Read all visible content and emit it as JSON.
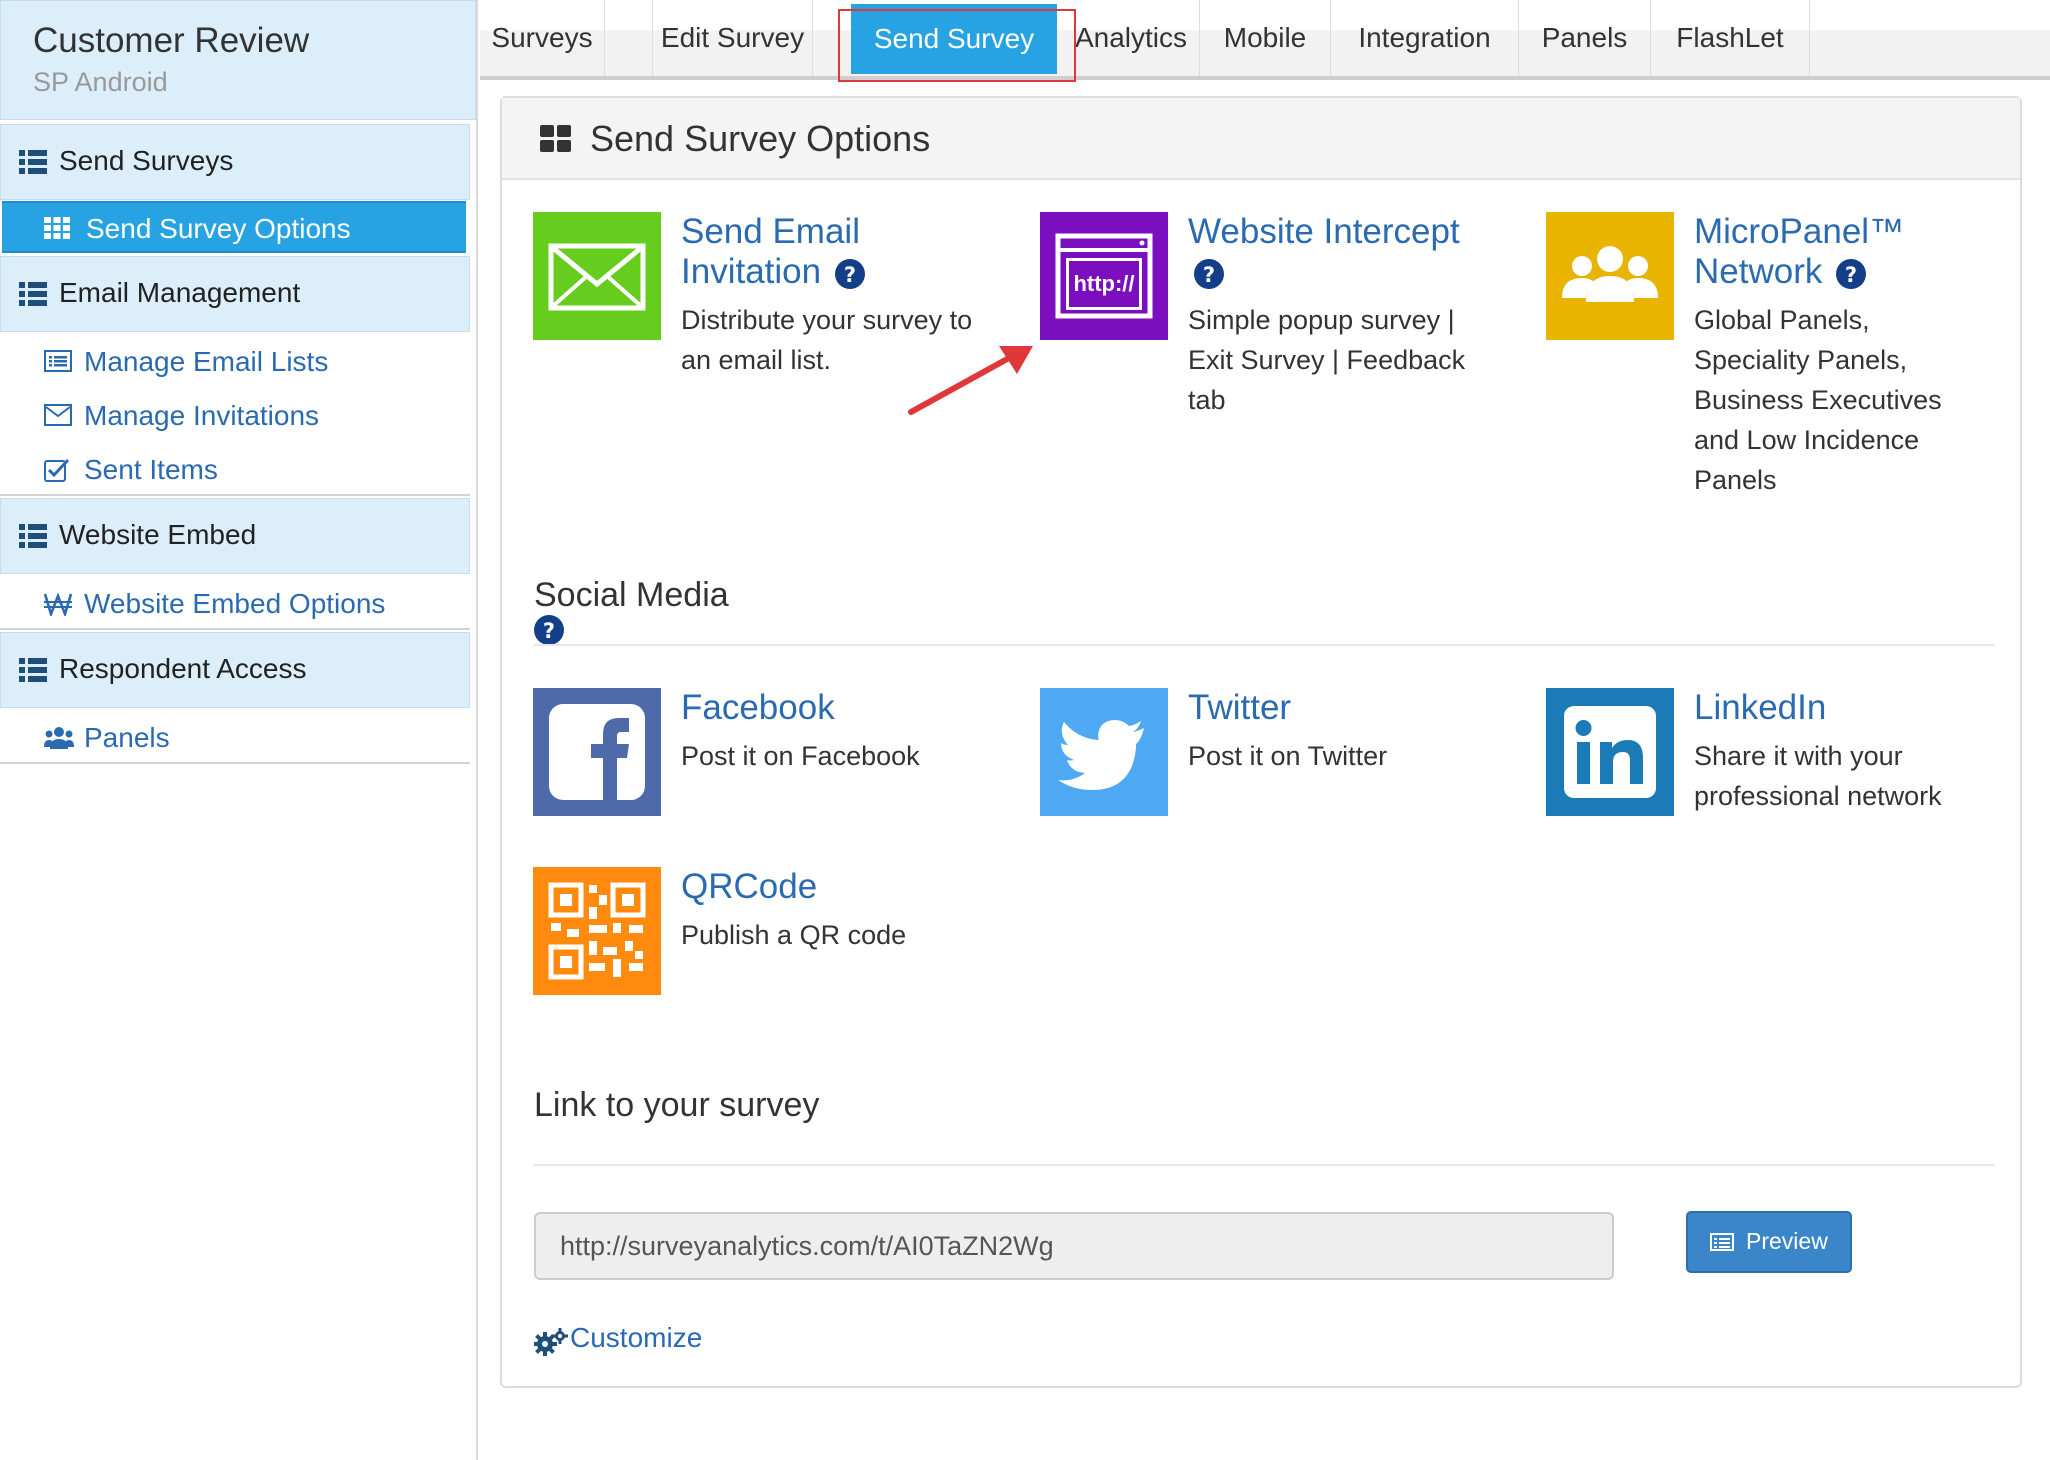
{
  "sidebar": {
    "title": "Customer Review",
    "subtitle": "SP Android",
    "sections": [
      {
        "label": "Send Surveys",
        "items": [
          {
            "label": "Send Survey Options",
            "icon": "grid-icon",
            "active": true
          }
        ]
      },
      {
        "label": "Email Management",
        "items": [
          {
            "label": "Manage Email Lists",
            "icon": "list-icon"
          },
          {
            "label": "Manage Invitations",
            "icon": "envelope-icon"
          },
          {
            "label": "Sent Items",
            "icon": "check-square-icon"
          }
        ]
      },
      {
        "label": "Website Embed",
        "items": [
          {
            "label": "Website Embed Options",
            "icon": "won-sign-icon"
          }
        ]
      },
      {
        "label": "Respondent Access",
        "items": [
          {
            "label": "Panels",
            "icon": "users-icon"
          }
        ]
      }
    ]
  },
  "tabs": [
    {
      "label": "Surveys"
    },
    {
      "label": "Edit Survey"
    },
    {
      "label": "Send Survey",
      "active": true
    },
    {
      "label": "Analytics"
    },
    {
      "label": "Mobile"
    },
    {
      "label": "Integration"
    },
    {
      "label": "Panels"
    },
    {
      "label": "FlashLet"
    }
  ],
  "panel": {
    "title": "Send Survey Options",
    "options": [
      {
        "title_line1": "Send Email",
        "title_line2": "Invitation",
        "desc": [
          "Distribute your survey to",
          "an email list."
        ],
        "icon": "envelope-icon",
        "color": "#66cc1e"
      },
      {
        "title_line1": "Website Intercept",
        "title_line2": "",
        "desc": [
          "Simple popup survey |",
          "Exit Survey | Feedback",
          "tab"
        ],
        "icon": "browser-http-icon",
        "icon_text": "http://",
        "color": "#7b0fbf"
      },
      {
        "title_line1": "MicroPanel™",
        "title_line2": "Network",
        "desc": [
          "Global Panels,",
          "Speciality Panels,",
          "Business Executives",
          "and Low Incidence",
          "Panels"
        ],
        "icon": "group-icon",
        "color": "#e8b400"
      }
    ],
    "social": {
      "title": "Social Media",
      "items": [
        {
          "title": "Facebook",
          "desc": [
            "Post it on Facebook"
          ],
          "icon": "facebook-icon",
          "color": "#4e6aa8"
        },
        {
          "title": "Twitter",
          "desc": [
            "Post it on Twitter"
          ],
          "icon": "twitter-icon",
          "color": "#4fa9f2"
        },
        {
          "title": "LinkedIn",
          "desc": [
            "Share it with your",
            "professional network"
          ],
          "icon": "linkedin-icon",
          "color": "#1b7bb6"
        },
        {
          "title": "QRCode",
          "desc": [
            "Publish a QR code"
          ],
          "icon": "qrcode-icon",
          "color": "#ff8a0d"
        }
      ]
    },
    "link": {
      "title": "Link to your survey",
      "url": "http://surveyanalytics.com/t/AI0TaZN2Wg",
      "preview_label": "Preview",
      "customize_label": "Customize"
    }
  },
  "colors": {
    "accent": "#27a3e3",
    "link": "#2a6ab0",
    "highlight": "#e0383a",
    "sidebar_bg": "#dbeefa",
    "button": "#3a86c8"
  }
}
